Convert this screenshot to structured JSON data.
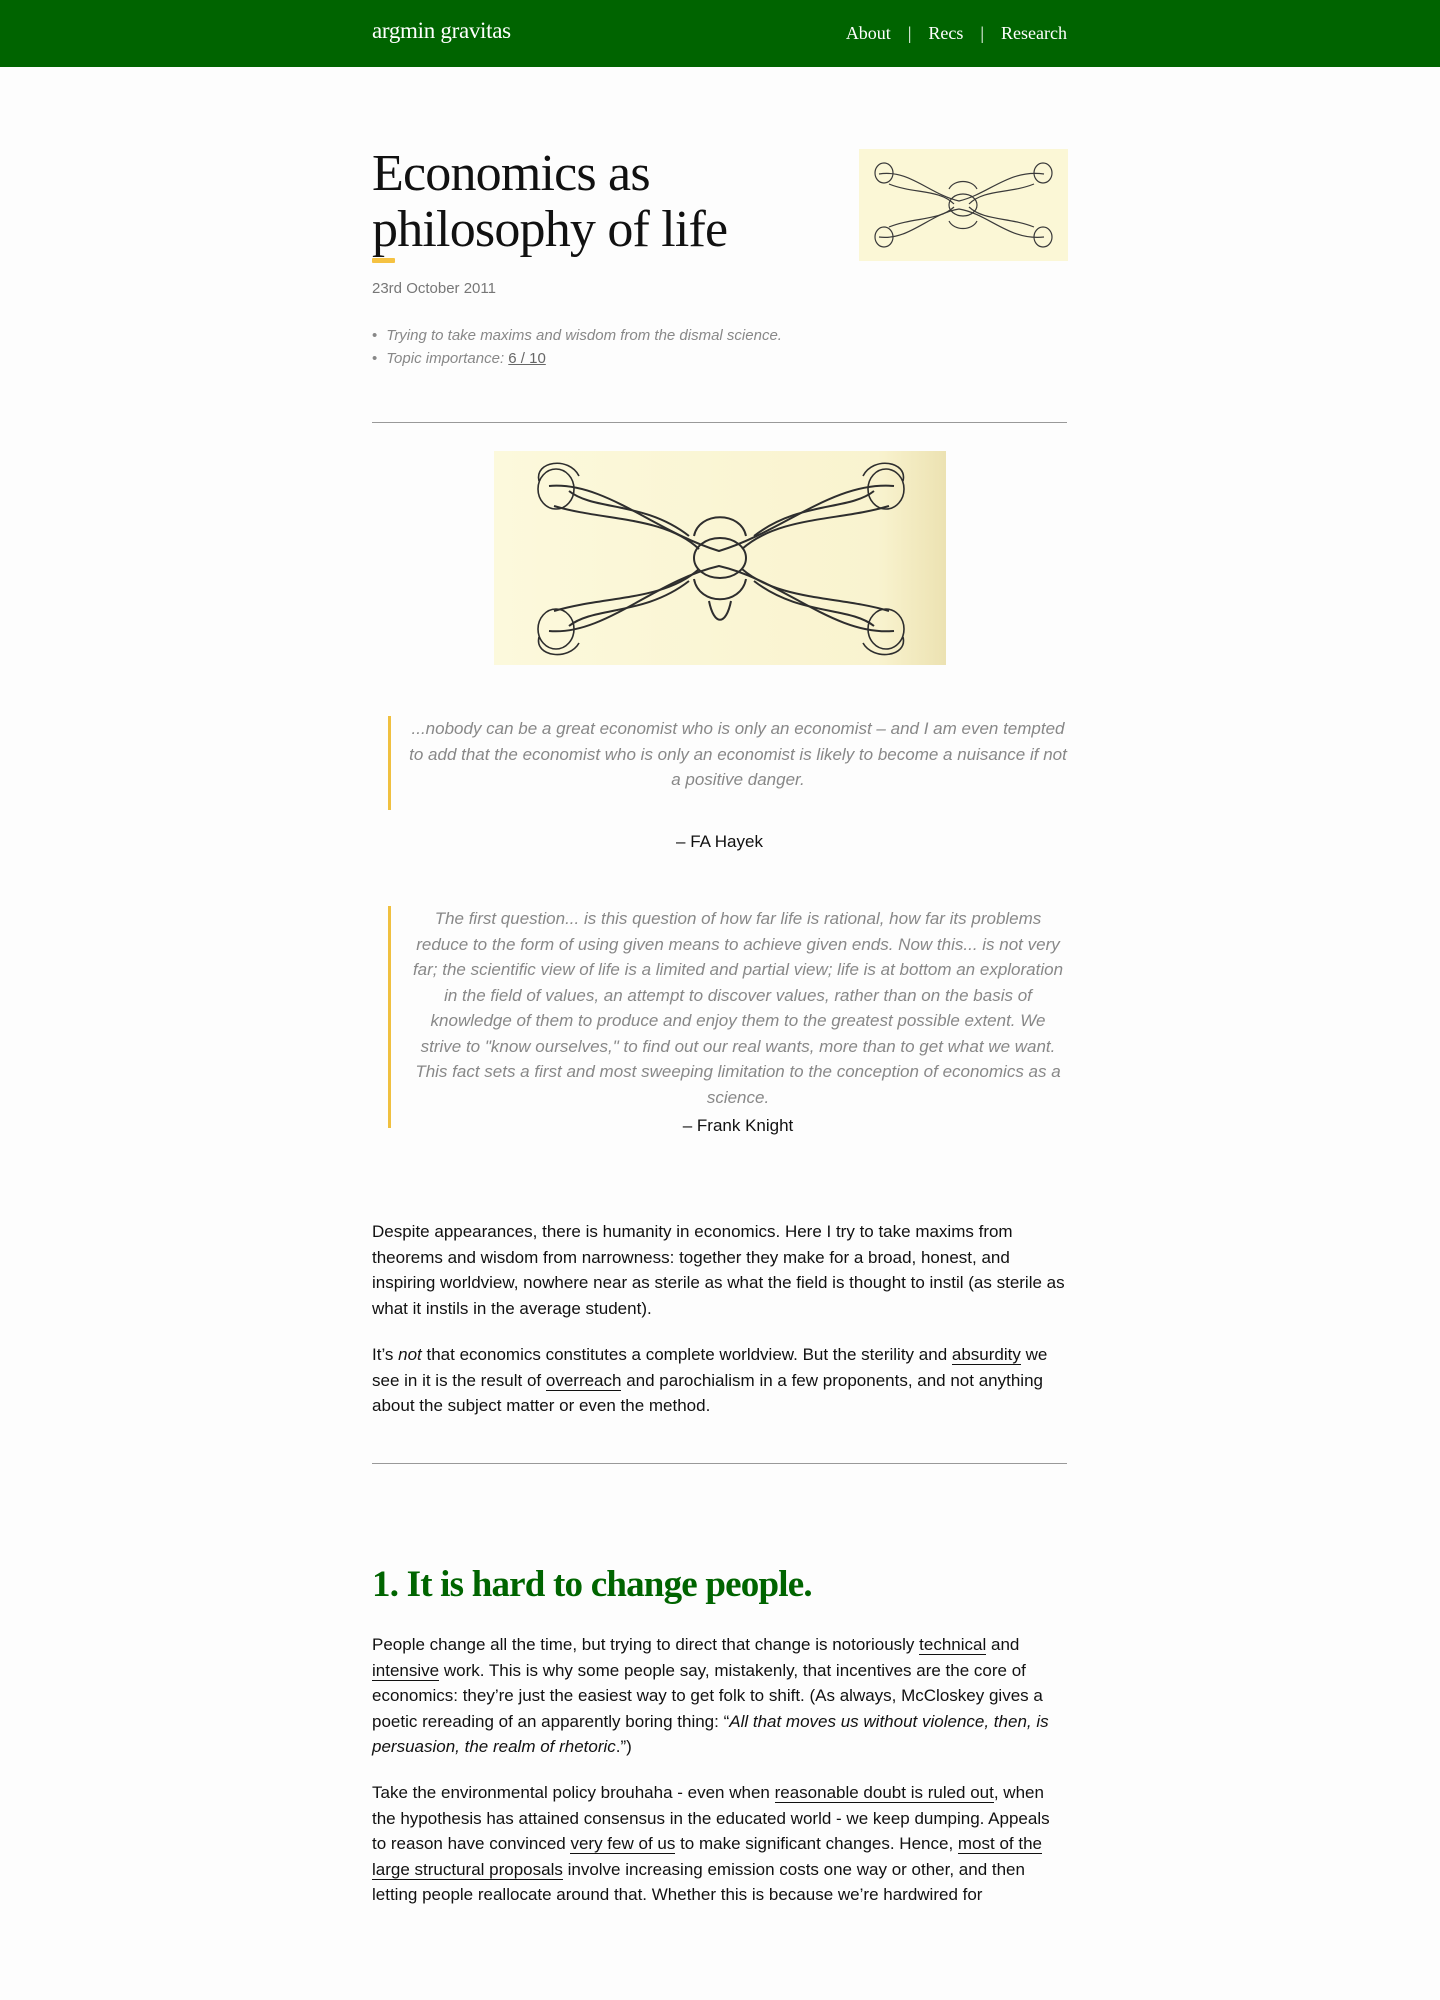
{
  "site": {
    "name": "argmin gravitas"
  },
  "nav": {
    "items": [
      "About",
      "Recs",
      "Research"
    ],
    "separator": "|"
  },
  "post": {
    "title": "Economics as philosophy of life",
    "date": "23rd October 2011",
    "summary": "Trying to take maxims and wisdom from the dismal science.",
    "importance_label": "Topic importance",
    "importance_value": "6 / 10"
  },
  "quotes": [
    {
      "text": "...nobody can be a great economist who is only an economist – and I am even tempted to add that the economist who is only an economist is likely to become a nuisance if not a positive danger.",
      "attribution": "– FA Hayek"
    },
    {
      "text": "The first question... is this question of how far life is rational, how far its problems reduce to the form of using given means to achieve given ends. Now this... is not very far; the scientific view of life is a limited and partial view; life is at bottom an exploration in the field of values, an attempt to discover values, rather than on the basis of knowledge of them to produce and enjoy them to the greatest possible extent. We strive to \"know ourselves,\" to find out our real wants, more than to get what we want. This fact sets a first and most sweeping limitation to the conception of economics as a science.",
      "attribution": "– Frank Knight"
    }
  ],
  "intro": {
    "p1": "Despite appearances, there is humanity in economics. Here I try to take maxims from theorems and wisdom from narrowness: together they make for a broad, honest, and inspiring worldview, nowhere near as sterile as what the field is thought to instil (as sterile as what it instils in the average student).",
    "p2": {
      "a": "It’s ",
      "not": "not",
      "b": " that economics constitutes a complete worldview. But the sterility and ",
      "link1": "absurdity",
      "c": " we see in it is the result of ",
      "link2": "overreach",
      "d": " and parochialism in a few proponents, and not anything about the subject matter or even the method."
    }
  },
  "section1": {
    "heading": "1. It is hard to change people.",
    "p1": {
      "a": "People change all the time, but trying to direct that change is notoriously ",
      "link1": "technical",
      "b": " and ",
      "link2": "intensive",
      "c": " work. This is why some people say, mistakenly, that incentives are the core of economics: they’re just the easiest way to get folk to shift. (As always, McCloskey gives a poetic rereading of an apparently boring thing: “",
      "quote": "All that moves us without violence, then, is persuasion, the realm of rhetoric",
      "d": ".”)"
    },
    "p2": {
      "a": "Take the environmental policy brouhaha - even when ",
      "link1": "reasonable doubt is ruled out",
      "b": ", when the hypothesis has attained consensus in the educated world - we keep dumping. Appeals to reason have convinced ",
      "link2": "very few of us",
      "c": " to make significant changes. Hence, ",
      "link3": "most of the large structural proposals",
      "d": " involve increasing emission costs one way or other, and then letting people reallocate around that. Whether this is because we’re hardwired for"
    }
  },
  "colors": {
    "header_green": "#006400",
    "accent_yellow": "#f0c040",
    "illustration_bg": "#fbf7d6"
  }
}
